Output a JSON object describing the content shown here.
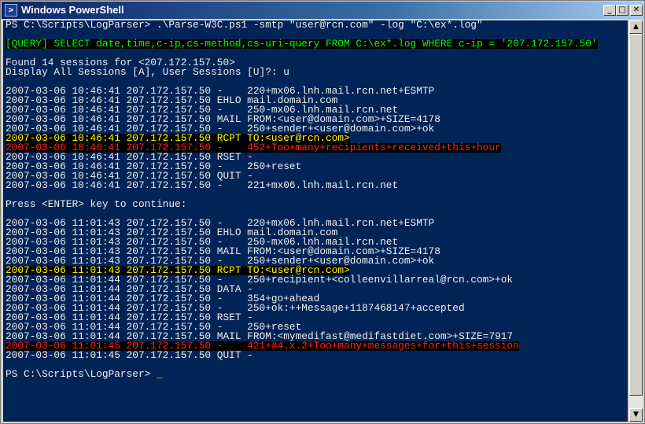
{
  "window": {
    "title": "Windows PowerShell",
    "icon_glyph": ">",
    "icon": "powershell-icon",
    "controls": {
      "minimize": "_",
      "maximize": "□",
      "close": "✕"
    }
  },
  "colors": {
    "console_bg": "#012456",
    "text": "#eeedf0",
    "highlight_yellow": "#ffff00",
    "highlight_red": "#ff2020",
    "highlight_green": "#00ff00",
    "highlight_bg": "#000000"
  },
  "scrollbar": {
    "up_icon": "scroll-up-arrow-icon",
    "down_icon": "scroll-down-arrow-icon",
    "up_glyph": "▲",
    "down_glyph": "▼"
  },
  "console": {
    "lines": [
      {
        "text": "PS C:\\Scripts\\LogParser> .\\Parse-W3C.ps1 -smtp \"user@rcn.com\" -log \"C:\\ex*.log\"",
        "style": ""
      },
      {
        "text": "",
        "style": ""
      },
      {
        "text": "[QUERY] SELECT date,time,c-ip,cs-method,cs-uri-query FROM C:\\ex*.log WHERE c-ip = '207.172.157.50'",
        "style": "green"
      },
      {
        "text": "",
        "style": ""
      },
      {
        "text": "Found 14 sessions for <207.172.157.50>",
        "style": ""
      },
      {
        "text": "Display All Sessions [A], User Sessions [U]?: u",
        "style": ""
      },
      {
        "text": "",
        "style": ""
      },
      {
        "text": "2007-03-06 10:46:41 207.172.157.50 -    220+mx06.lnh.mail.rcn.net+ESMTP",
        "style": ""
      },
      {
        "text": "2007-03-06 10:46:41 207.172.157.50 EHLO mail.domain.com",
        "style": ""
      },
      {
        "text": "2007-03-06 10:46:41 207.172.157.50 -    250-mx06.lnh.mail.rcn.net",
        "style": ""
      },
      {
        "text": "2007-03-06 10:46:41 207.172.157.50 MAIL FROM:<user@domain.com>+SIZE=4178",
        "style": ""
      },
      {
        "text": "2007-03-06 10:46:41 207.172.157.50 -    250+sender+<user@domain.com>+ok",
        "style": ""
      },
      {
        "text": "2007-03-06 10:46:41 207.172.157.50 RCPT TO:<user@rcn.com>",
        "style": "yellow"
      },
      {
        "text": "2007-03-06 10:46:41 207.172.157.50 -    452+Too+many+recipients+received+this+hour",
        "style": "red"
      },
      {
        "text": "2007-03-06 10:46:41 207.172.157.50 RSET -",
        "style": ""
      },
      {
        "text": "2007-03-06 10:46:41 207.172.157.50 -    250+reset",
        "style": ""
      },
      {
        "text": "2007-03-06 10:46:41 207.172.157.50 QUIT -",
        "style": ""
      },
      {
        "text": "2007-03-06 10:46:41 207.172.157.50 -    221+mx06.lnh.mail.rcn.net",
        "style": ""
      },
      {
        "text": "",
        "style": ""
      },
      {
        "text": "Press <ENTER> key to continue:",
        "style": ""
      },
      {
        "text": "",
        "style": ""
      },
      {
        "text": "2007-03-06 11:01:43 207.172.157.50 -    220+mx06.lnh.mail.rcn.net+ESMTP",
        "style": ""
      },
      {
        "text": "2007-03-06 11:01:43 207.172.157.50 EHLO mail.domain.com",
        "style": ""
      },
      {
        "text": "2007-03-06 11:01:43 207.172.157.50 -    250-mx06.lnh.mail.rcn.net",
        "style": ""
      },
      {
        "text": "2007-03-06 11:01:43 207.172.157.50 MAIL FROM:<user@domain.com>+SIZE=4178",
        "style": ""
      },
      {
        "text": "2007-03-06 11:01:43 207.172.157.50 -    250+sender+<user@domain.com>+ok",
        "style": ""
      },
      {
        "text": "2007-03-06 11:01:43 207.172.157.50 RCPT TO:<user@rcn.com>",
        "style": "yellow"
      },
      {
        "text": "2007-03-06 11:01:44 207.172.157.50 -    250+recipient+<colleenvillarreal@rcn.com>+ok",
        "style": ""
      },
      {
        "text": "2007-03-06 11:01:44 207.172.157.50 DATA -",
        "style": ""
      },
      {
        "text": "2007-03-06 11:01:44 207.172.157.50 -    354+go+ahead",
        "style": ""
      },
      {
        "text": "2007-03-06 11:01:44 207.172.157.50 -    250+ok:++Message+1187468147+accepted",
        "style": ""
      },
      {
        "text": "2007-03-06 11:01:44 207.172.157.50 RSET -",
        "style": ""
      },
      {
        "text": "2007-03-06 11:01:44 207.172.157.50 -    250+reset",
        "style": ""
      },
      {
        "text": "2007-03-06 11:01:44 207.172.157.50 MAIL FROM:<mymedifast@medifastdiet.com>+SIZE=7917",
        "style": ""
      },
      {
        "text": "2007-03-06 11:01:45 207.172.157.50 -    421+#4.x.2+Too+many+messages+for+this+session",
        "style": "red"
      },
      {
        "text": "2007-03-06 11:01:45 207.172.157.50 QUIT -",
        "style": ""
      },
      {
        "text": "",
        "style": ""
      },
      {
        "text": "PS C:\\Scripts\\LogParser> ",
        "style": "",
        "cursor": "_"
      }
    ]
  }
}
